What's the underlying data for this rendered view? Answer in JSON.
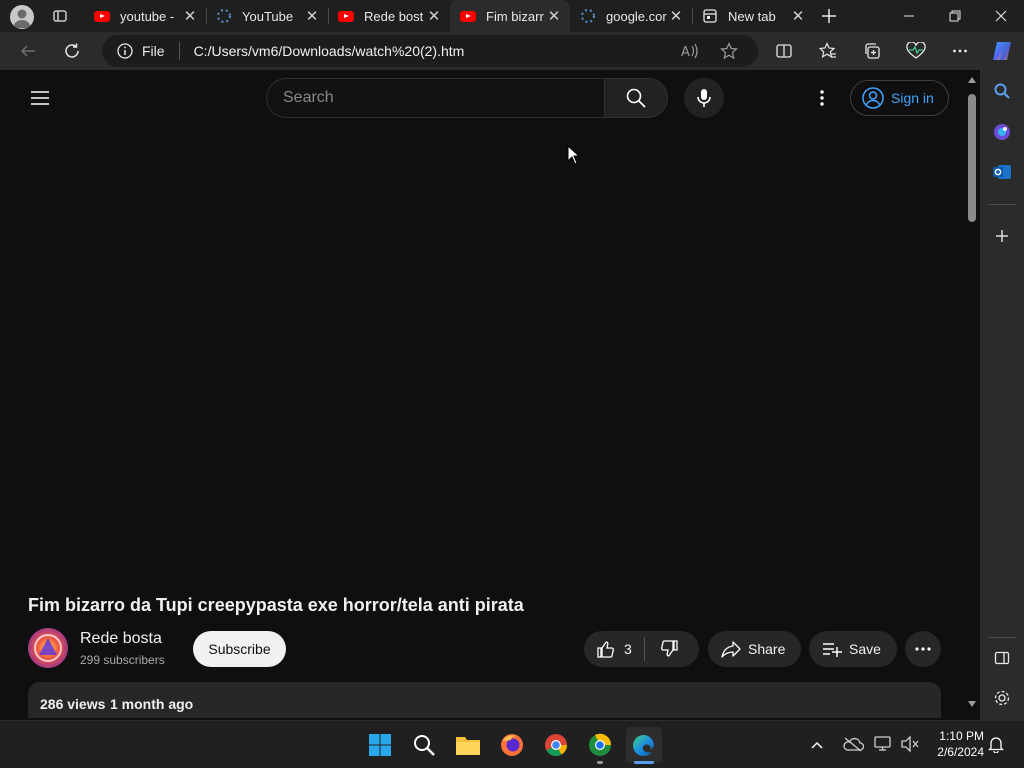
{
  "browser": {
    "tabs": [
      {
        "label": "youtube -",
        "icon": "youtube-icon"
      },
      {
        "label": "YouTube",
        "icon": "loading-icon"
      },
      {
        "label": "Rede bost",
        "icon": "youtube-icon"
      },
      {
        "label": "Fim bizarr",
        "icon": "youtube-icon",
        "active": true
      },
      {
        "label": "google.cor",
        "icon": "loading-icon"
      },
      {
        "label": "New tab",
        "icon": "newtab-icon"
      }
    ],
    "address": {
      "scheme_label": "File",
      "url": "C:/Users/vm6/Downloads/watch%20(2).htm"
    }
  },
  "youtube": {
    "search_placeholder": "Search",
    "sign_in_label": "Sign in",
    "video": {
      "title": "Fim bizarro da Tupi creepypasta exe horror/tela anti pirata",
      "channel_name": "Rede bosta",
      "subscribers": "299 subscribers",
      "subscribe_label": "Subscribe",
      "likes": "3",
      "share_label": "Share",
      "save_label": "Save",
      "views": "286 views",
      "age": "1 month ago"
    }
  },
  "taskbar": {
    "time": "1:10 PM",
    "date": "2/6/2024"
  },
  "colors": {
    "youtube_red": "#ff0000",
    "sign_in_blue": "#3ea6ff",
    "page_bg": "#0f0f0f",
    "chrome_bg": "#2b2b2b"
  }
}
